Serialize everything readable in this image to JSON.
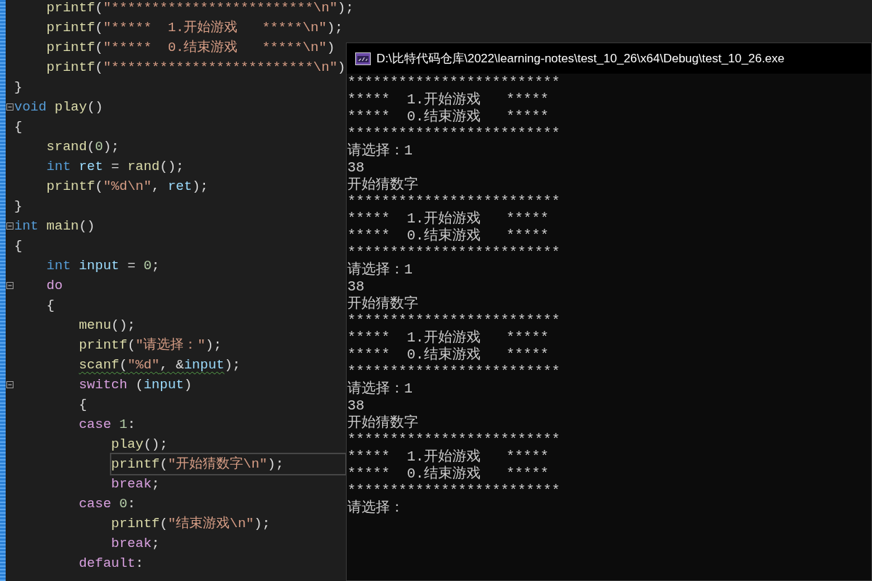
{
  "editor": {
    "lines": [
      {
        "children": [
          {
            "fold": false,
            "current": false,
            "warning": false,
            "tokens": [
              {
                "kind": "fn",
                "text": "printf"
              },
              {
                "kind": "p",
                "text": "("
              },
              {
                "kind": "str",
                "text": "\"*************************\\n\""
              },
              {
                "kind": "p",
                "text": ");"
              }
            ]
          },
          {
            "fold": false,
            "current": false,
            "warning": false,
            "tokens": [
              {
                "kind": "fn",
                "text": "printf"
              },
              {
                "kind": "p",
                "text": "("
              },
              {
                "kind": "str",
                "text": "\"*****  1.开始游戏   *****\\n\""
              },
              {
                "kind": "p",
                "text": ");"
              }
            ]
          },
          {
            "fold": false,
            "current": false,
            "warning": false,
            "tokens": [
              {
                "kind": "fn",
                "text": "printf"
              },
              {
                "kind": "p",
                "text": "("
              },
              {
                "kind": "str",
                "text": "\"*****  0.结束游戏   *****\\n\""
              },
              {
                "kind": "p",
                "text": ")"
              }
            ]
          },
          {
            "fold": false,
            "current": false,
            "warning": false,
            "tokens": [
              {
                "kind": "fn",
                "text": "printf"
              },
              {
                "kind": "p",
                "text": "("
              },
              {
                "kind": "str",
                "text": "\"*************************\\n\""
              },
              {
                "kind": "p",
                "text": ")"
              }
            ]
          }
        ]
      },
      {
        "fold": false,
        "current": false,
        "warning": false,
        "tokens": [
          {
            "kind": "p",
            "text": "}"
          }
        ]
      },
      {
        "fold": true,
        "current": false,
        "warning": false,
        "tokens": [
          {
            "kind": "kw",
            "text": "void "
          },
          {
            "kind": "fn",
            "text": "play"
          },
          {
            "kind": "p",
            "text": "()"
          }
        ]
      },
      {
        "fold": false,
        "current": false,
        "warning": false,
        "tokens": [
          {
            "kind": "p",
            "text": "{"
          }
        ]
      },
      {
        "children": [
          {
            "fold": false,
            "current": false,
            "warning": false,
            "tokens": [
              {
                "kind": "fn",
                "text": "srand"
              },
              {
                "kind": "p",
                "text": "("
              },
              {
                "kind": "num",
                "text": "0"
              },
              {
                "kind": "p",
                "text": ");"
              }
            ]
          },
          {
            "fold": false,
            "current": false,
            "warning": false,
            "tokens": [
              {
                "kind": "kw",
                "text": "int "
              },
              {
                "kind": "var",
                "text": "ret "
              },
              {
                "kind": "p",
                "text": "= "
              },
              {
                "kind": "fn",
                "text": "rand"
              },
              {
                "kind": "p",
                "text": "();"
              }
            ]
          },
          {
            "fold": false,
            "current": false,
            "warning": false,
            "tokens": [
              {
                "kind": "fn",
                "text": "printf"
              },
              {
                "kind": "p",
                "text": "("
              },
              {
                "kind": "str",
                "text": "\"%d\\n\""
              },
              {
                "kind": "p",
                "text": ", "
              },
              {
                "kind": "var",
                "text": "ret"
              },
              {
                "kind": "p",
                "text": ");"
              }
            ]
          }
        ]
      },
      {
        "fold": false,
        "current": false,
        "warning": false,
        "tokens": [
          {
            "kind": "p",
            "text": "}"
          }
        ]
      },
      {
        "fold": true,
        "current": false,
        "warning": false,
        "tokens": [
          {
            "kind": "kw",
            "text": "int "
          },
          {
            "kind": "fn",
            "text": "main"
          },
          {
            "kind": "p",
            "text": "()"
          }
        ]
      },
      {
        "fold": false,
        "current": false,
        "warning": false,
        "tokens": [
          {
            "kind": "p",
            "text": "{"
          }
        ]
      },
      {
        "children": [
          {
            "fold": false,
            "current": false,
            "warning": false,
            "tokens": [
              {
                "kind": "kw",
                "text": "int "
              },
              {
                "kind": "var",
                "text": "input "
              },
              {
                "kind": "p",
                "text": "= "
              },
              {
                "kind": "num",
                "text": "0"
              },
              {
                "kind": "p",
                "text": ";"
              }
            ]
          },
          {
            "fold": true,
            "current": false,
            "warning": false,
            "tokens": [
              {
                "kind": "ctl",
                "text": "do"
              }
            ]
          },
          {
            "fold": false,
            "current": false,
            "warning": false,
            "tokens": [
              {
                "kind": "p",
                "text": "{"
              }
            ]
          },
          {
            "children": [
              {
                "fold": false,
                "current": false,
                "warning": false,
                "tokens": [
                  {
                    "kind": "fn",
                    "text": "menu"
                  },
                  {
                    "kind": "p",
                    "text": "();"
                  }
                ]
              },
              {
                "fold": false,
                "current": false,
                "warning": false,
                "tokens": [
                  {
                    "kind": "fn",
                    "text": "printf"
                  },
                  {
                    "kind": "p",
                    "text": "("
                  },
                  {
                    "kind": "str",
                    "text": "\"请选择：\""
                  },
                  {
                    "kind": "p",
                    "text": ");"
                  }
                ]
              },
              {
                "fold": false,
                "current": false,
                "warning": true,
                "tokens": [
                  {
                    "kind": "fn",
                    "text": "scanf"
                  },
                  {
                    "kind": "p",
                    "text": "("
                  },
                  {
                    "kind": "str",
                    "text": "\"%d\""
                  },
                  {
                    "kind": "p",
                    "text": ", &"
                  },
                  {
                    "kind": "var",
                    "text": "input"
                  },
                  {
                    "kind": "p",
                    "text": ");"
                  }
                ]
              },
              {
                "fold": true,
                "current": false,
                "warning": false,
                "tokens": [
                  {
                    "kind": "ctl",
                    "text": "switch "
                  },
                  {
                    "kind": "p",
                    "text": "("
                  },
                  {
                    "kind": "var",
                    "text": "input"
                  },
                  {
                    "kind": "p",
                    "text": ")"
                  }
                ]
              },
              {
                "fold": false,
                "current": false,
                "warning": false,
                "tokens": [
                  {
                    "kind": "p",
                    "text": "{"
                  }
                ]
              },
              {
                "fold": false,
                "current": false,
                "warning": false,
                "tokens": [
                  {
                    "kind": "ctl",
                    "text": "case "
                  },
                  {
                    "kind": "num",
                    "text": "1"
                  },
                  {
                    "kind": "p",
                    "text": ":"
                  }
                ]
              },
              {
                "children": [
                  {
                    "fold": false,
                    "current": false,
                    "warning": false,
                    "tokens": [
                      {
                        "kind": "fn",
                        "text": "play"
                      },
                      {
                        "kind": "p",
                        "text": "();"
                      }
                    ]
                  },
                  {
                    "fold": false,
                    "current": true,
                    "warning": false,
                    "tokens": [
                      {
                        "kind": "fn",
                        "text": "printf"
                      },
                      {
                        "kind": "p",
                        "text": "("
                      },
                      {
                        "kind": "str",
                        "text": "\"开始猜数字\\n\""
                      },
                      {
                        "kind": "p",
                        "text": ");"
                      }
                    ]
                  },
                  {
                    "fold": false,
                    "current": false,
                    "warning": false,
                    "tokens": [
                      {
                        "kind": "ctl",
                        "text": "break"
                      },
                      {
                        "kind": "p",
                        "text": ";"
                      }
                    ]
                  }
                ]
              },
              {
                "fold": false,
                "current": false,
                "warning": false,
                "tokens": [
                  {
                    "kind": "ctl",
                    "text": "case "
                  },
                  {
                    "kind": "num",
                    "text": "0"
                  },
                  {
                    "kind": "p",
                    "text": ":"
                  }
                ]
              },
              {
                "children": [
                  {
                    "fold": false,
                    "current": false,
                    "warning": false,
                    "tokens": [
                      {
                        "kind": "fn",
                        "text": "printf"
                      },
                      {
                        "kind": "p",
                        "text": "("
                      },
                      {
                        "kind": "str",
                        "text": "\"结束游戏\\n\""
                      },
                      {
                        "kind": "p",
                        "text": ");"
                      }
                    ]
                  },
                  {
                    "fold": false,
                    "current": false,
                    "warning": false,
                    "tokens": [
                      {
                        "kind": "ctl",
                        "text": "break"
                      },
                      {
                        "kind": "p",
                        "text": ";"
                      }
                    ]
                  }
                ]
              },
              {
                "fold": false,
                "current": false,
                "warning": false,
                "tokens": [
                  {
                    "kind": "ctl",
                    "text": "default"
                  },
                  {
                    "kind": "p",
                    "text": ":"
                  }
                ]
              }
            ]
          }
        ]
      }
    ]
  },
  "console": {
    "title": "D:\\比特代码仓库\\2022\\learning-notes\\test_10_26\\x64\\Debug\\test_10_26.exe",
    "lines": [
      "*************************",
      "*****  1.开始游戏   *****",
      "*****  0.结束游戏   *****",
      "*************************",
      "请选择：1",
      "38",
      "开始猜数字",
      "*************************",
      "*****  1.开始游戏   *****",
      "*****  0.结束游戏   *****",
      "*************************",
      "请选择：1",
      "38",
      "开始猜数字",
      "*************************",
      "*****  1.开始游戏   *****",
      "*****  0.结束游戏   *****",
      "*************************",
      "请选择：1",
      "38",
      "开始猜数字",
      "*************************",
      "*****  1.开始游戏   *****",
      "*****  0.结束游戏   *****",
      "*************************",
      "请选择："
    ]
  }
}
